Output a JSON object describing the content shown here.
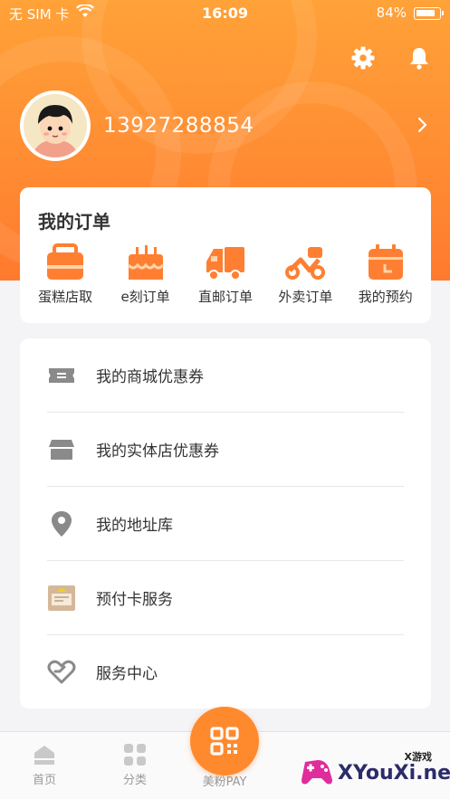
{
  "status_bar": {
    "carrier": "无 SIM 卡",
    "time": "16:09",
    "battery": "84%"
  },
  "header_icons": [
    "settings-icon",
    "bell-icon"
  ],
  "profile": {
    "phone": "13927288854"
  },
  "orders": {
    "title": "我的订单",
    "items": [
      {
        "label": "蛋糕店取",
        "icon": "cake-box-icon"
      },
      {
        "label": "e刻订单",
        "icon": "cake-icon"
      },
      {
        "label": "直邮订单",
        "icon": "truck-icon"
      },
      {
        "label": "外卖订单",
        "icon": "scooter-icon"
      },
      {
        "label": "我的预约",
        "icon": "calendar-icon"
      }
    ]
  },
  "menu": [
    {
      "label": "我的商城优惠券",
      "icon": "coupon-icon"
    },
    {
      "label": "我的实体店优惠券",
      "icon": "store-icon"
    },
    {
      "label": "我的地址库",
      "icon": "location-icon"
    },
    {
      "label": "预付卡服务",
      "icon": "prepaid-card-icon"
    },
    {
      "label": "服务中心",
      "icon": "service-heart-icon"
    }
  ],
  "tabbar": {
    "home": "首页",
    "category": "分类",
    "pay": "美粉PAY"
  },
  "watermark": {
    "text": "XYouXi.net",
    "small": "X游戏"
  },
  "colors": {
    "accent": "#ff8a2e",
    "icon_orange": "#ff7f32",
    "icon_gray": "#8a8a8a"
  }
}
